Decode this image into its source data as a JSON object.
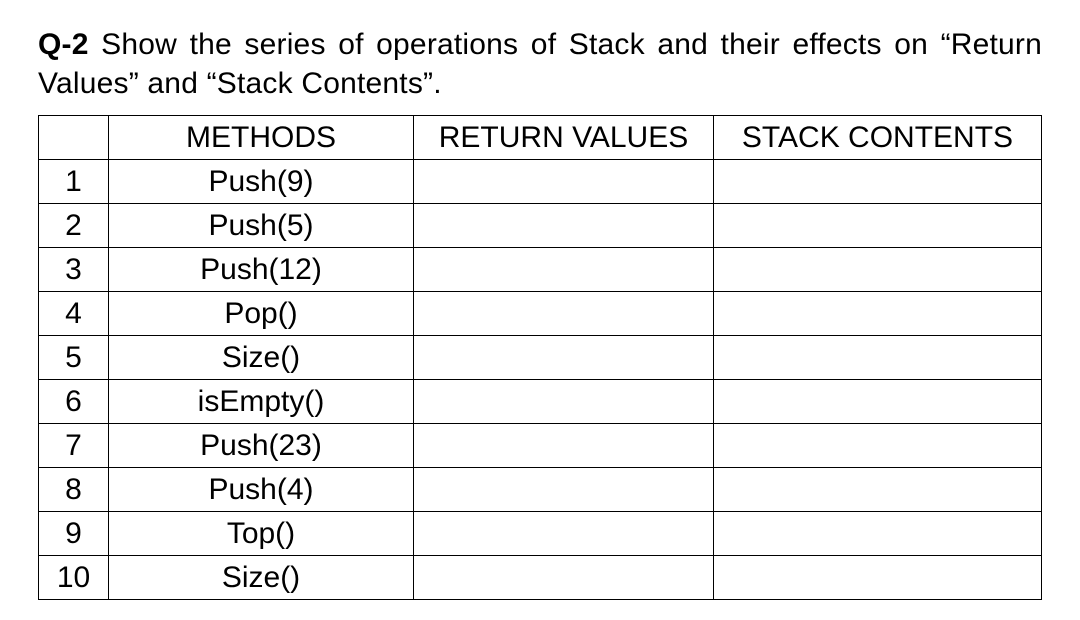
{
  "question_prefix": "Q-2 ",
  "question_text": "Show the series of operations of Stack and their effects on “Return Values” and “Stack Contents”.",
  "headers": {
    "index": "",
    "methods": "METHODS",
    "return_values": "RETURN VALUES",
    "stack_contents": "STACK CONTENTS"
  },
  "rows": [
    {
      "n": "1",
      "method": "Push(9)",
      "ret": "",
      "stack": ""
    },
    {
      "n": "2",
      "method": "Push(5)",
      "ret": "",
      "stack": ""
    },
    {
      "n": "3",
      "method": "Push(12)",
      "ret": "",
      "stack": ""
    },
    {
      "n": "4",
      "method": "Pop()",
      "ret": "",
      "stack": ""
    },
    {
      "n": "5",
      "method": "Size()",
      "ret": "",
      "stack": ""
    },
    {
      "n": "6",
      "method": "isEmpty()",
      "ret": "",
      "stack": ""
    },
    {
      "n": "7",
      "method": "Push(23)",
      "ret": "",
      "stack": ""
    },
    {
      "n": "8",
      "method": "Push(4)",
      "ret": "",
      "stack": ""
    },
    {
      "n": "9",
      "method": "Top()",
      "ret": "",
      "stack": ""
    },
    {
      "n": "10",
      "method": "Size()",
      "ret": "",
      "stack": ""
    }
  ]
}
